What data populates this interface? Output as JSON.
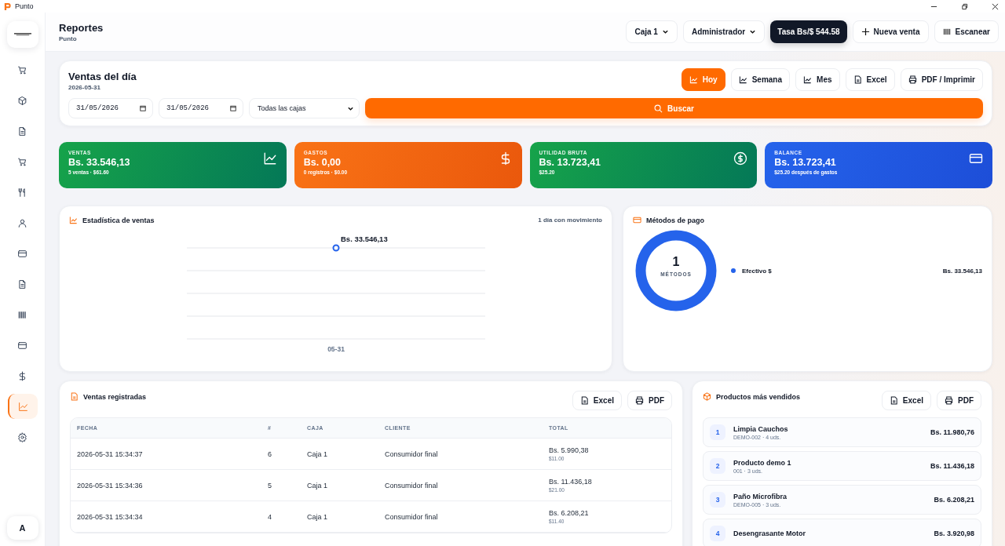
{
  "window": {
    "title": "Punto"
  },
  "sidebar": {
    "items": [
      {
        "selected": false
      },
      {
        "selected": false
      },
      {
        "selected": false
      },
      {
        "selected": false
      },
      {
        "selected": false
      },
      {
        "selected": false
      },
      {
        "selected": false
      },
      {
        "selected": false
      },
      {
        "selected": false
      },
      {
        "selected": false
      },
      {
        "selected": false
      },
      {
        "selected": true
      },
      {
        "selected": false
      }
    ],
    "user_initial": "A"
  },
  "header": {
    "title": "Reportes",
    "subtitle": "Punto",
    "register_select": "Caja 1",
    "user_select": "Administrador",
    "rate": "Tasa Bs/$ 544.58",
    "new_sale": "Nueva venta",
    "scan": "Escanear"
  },
  "filter": {
    "title": "Ventas del día",
    "date": "2026-05-31",
    "period_tabs": [
      {
        "label": "Hoy",
        "selected": true
      },
      {
        "label": "Semana",
        "selected": false
      },
      {
        "label": "Mes",
        "selected": false
      }
    ],
    "export_buttons": [
      {
        "label": "Excel",
        "kind": "excel"
      },
      {
        "label": "PDF / Imprimir",
        "kind": "pdf"
      }
    ],
    "from": "31/05/2026",
    "to": "31/05/2026",
    "register": "Todas las cajas",
    "search": "Buscar"
  },
  "stats": [
    {
      "kind": "sales",
      "label": "VENTAS",
      "value": "Bs. 33.546,13",
      "note": "5 ventas · $61.60"
    },
    {
      "kind": "expenses",
      "label": "GASTOS",
      "value": "Bs. 0,00",
      "note": "0 registros · $0.00"
    },
    {
      "kind": "profit",
      "label": "UTILIDAD BRUTA",
      "value": "Bs. 13.723,41",
      "note": "$25.20"
    },
    {
      "kind": "balance",
      "label": "BALANCE",
      "value": "Bs. 13.723,41",
      "note": "$25.20 después de gastos"
    }
  ],
  "sales_chart": {
    "title": "Estadística de ventas",
    "note": "1 día con movimiento",
    "value_label": "Bs. 33.546,13",
    "category": "05-31"
  },
  "payment_methods": {
    "title": "Métodos de pago",
    "count": "1",
    "count_label": "MÉTODOS",
    "legend": [
      {
        "label": "Efectivo $",
        "value": "Bs. 33.546,13",
        "color": "#2563eb"
      }
    ]
  },
  "sales_table": {
    "title": "Ventas registradas",
    "buttons": [
      {
        "label": "Excel",
        "kind": "excel"
      },
      {
        "label": "PDF",
        "kind": "pdf"
      }
    ],
    "columns": [
      "FECHA",
      "#",
      "CAJA",
      "CLIENTE",
      "TOTAL"
    ],
    "rows": [
      {
        "date": "2026-05-31 15:34:37",
        "number": "6",
        "register": "Caja 1",
        "client": "Consumidor final",
        "total": "Bs. 5.990,38",
        "total_usd": "$11.00"
      },
      {
        "date": "2026-05-31 15:34:36",
        "number": "5",
        "register": "Caja 1",
        "client": "Consumidor final",
        "total": "Bs. 11.436,18",
        "total_usd": "$21.00"
      },
      {
        "date": "2026-05-31 15:34:34",
        "number": "4",
        "register": "Caja 1",
        "client": "Consumidor final",
        "total": "Bs. 6.208,21",
        "total_usd": "$11.40"
      }
    ]
  },
  "top_products": {
    "title": "Productos más vendidos",
    "buttons": [
      {
        "label": "Excel",
        "kind": "excel"
      },
      {
        "label": "PDF",
        "kind": "pdf"
      }
    ],
    "items": [
      {
        "rank": "1",
        "name": "Limpia Cauchos",
        "detail": "DEMO-002 · 4 uds.",
        "total": "Bs. 11.980,76"
      },
      {
        "rank": "2",
        "name": "Producto demo 1",
        "detail": "001 · 3 uds.",
        "total": "Bs. 11.436,18"
      },
      {
        "rank": "3",
        "name": "Paño Microfibra",
        "detail": "DEMO-005 · 3 uds.",
        "total": "Bs. 6.208,21"
      },
      {
        "rank": "4",
        "name": "Desengrasante Motor",
        "total": "Bs. 3.920,98"
      }
    ]
  }
}
